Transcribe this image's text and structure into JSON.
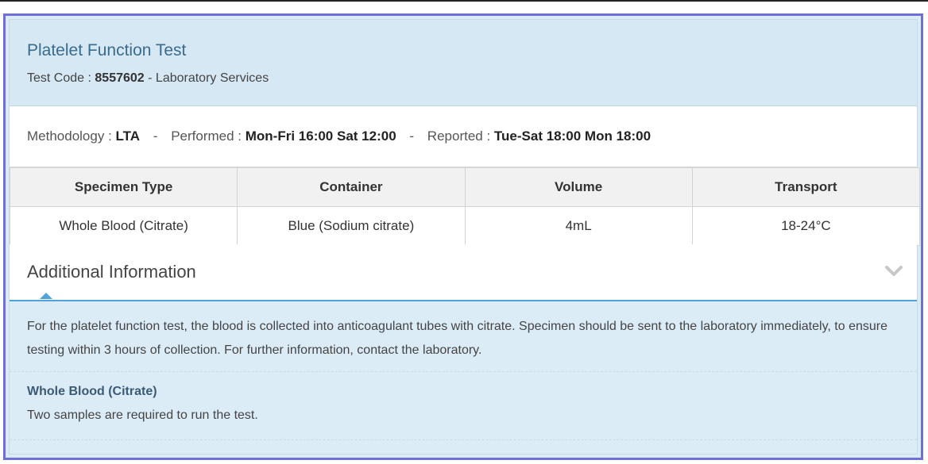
{
  "test": {
    "title": "Platelet Function Test",
    "code_label": "Test Code :",
    "code": "8557602",
    "department": "- Laboratory Services"
  },
  "meta": {
    "methodology_label": "Methodology :",
    "methodology": "LTA",
    "performed_label": "Performed :",
    "performed": "Mon-Fri 16:00 Sat 12:00",
    "reported_label": "Reported :",
    "reported": "Tue-Sat 18:00 Mon 18:00",
    "separator": "-"
  },
  "specimen_table": {
    "headers": [
      "Specimen Type",
      "Container",
      "Volume",
      "Transport"
    ],
    "rows": [
      [
        "Whole Blood (Citrate)",
        "Blue (Sodium citrate)",
        "4mL",
        "18-24°C"
      ]
    ]
  },
  "additional": {
    "title": "Additional Information",
    "toggle_icon": "chevron-down-icon",
    "note": "For the platelet function test, the blood is collected into anticoagulant tubes with citrate. Specimen should be sent to the laboratory immediately, to ensure testing within 3 hours of collection. For further information, contact the laboratory.",
    "specimen_heading": "Whole Blood (Citrate)",
    "specimen_note": "Two samples are required to run the test."
  },
  "colors": {
    "card_border": "#6f6fd8",
    "panel_bg": "#dcecf7",
    "accent": "#4fa3d8",
    "title": "#3a6b8c"
  }
}
